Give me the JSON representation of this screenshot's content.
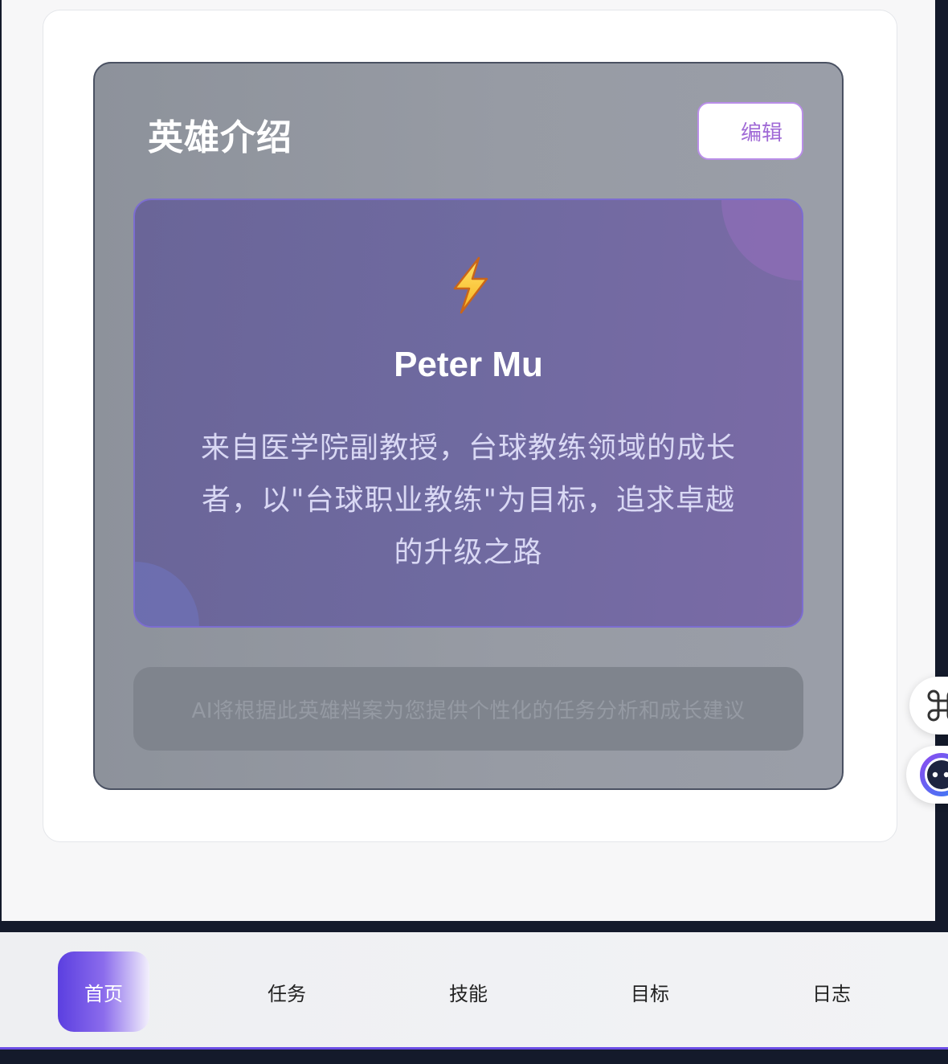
{
  "hero_panel": {
    "title": "英雄介绍",
    "edit_label": "编辑"
  },
  "intro_card": {
    "icon": "lightning-bolt-icon",
    "name": "Peter Mu",
    "description": "来自医学院副教授，台球教练领域的成长者，以\"台球职业教练\"为目标，追求卓越的升级之路"
  },
  "ai_note": "AI将根据此英雄档案为您提供个性化的任务分析和成长建议",
  "floating_buttons": {
    "command_icon": "command-icon",
    "assistant_icon": "ai-assistant-icon"
  },
  "bottom_nav": {
    "items": [
      {
        "label": "首页",
        "active": true
      },
      {
        "label": "任务",
        "active": false
      },
      {
        "label": "技能",
        "active": false
      },
      {
        "label": "目标",
        "active": false
      },
      {
        "label": "日志",
        "active": false
      }
    ]
  },
  "colors": {
    "accent": "#6b4de6",
    "edit_border": "#b98ee8",
    "intro_card": "#6f6aa0"
  }
}
